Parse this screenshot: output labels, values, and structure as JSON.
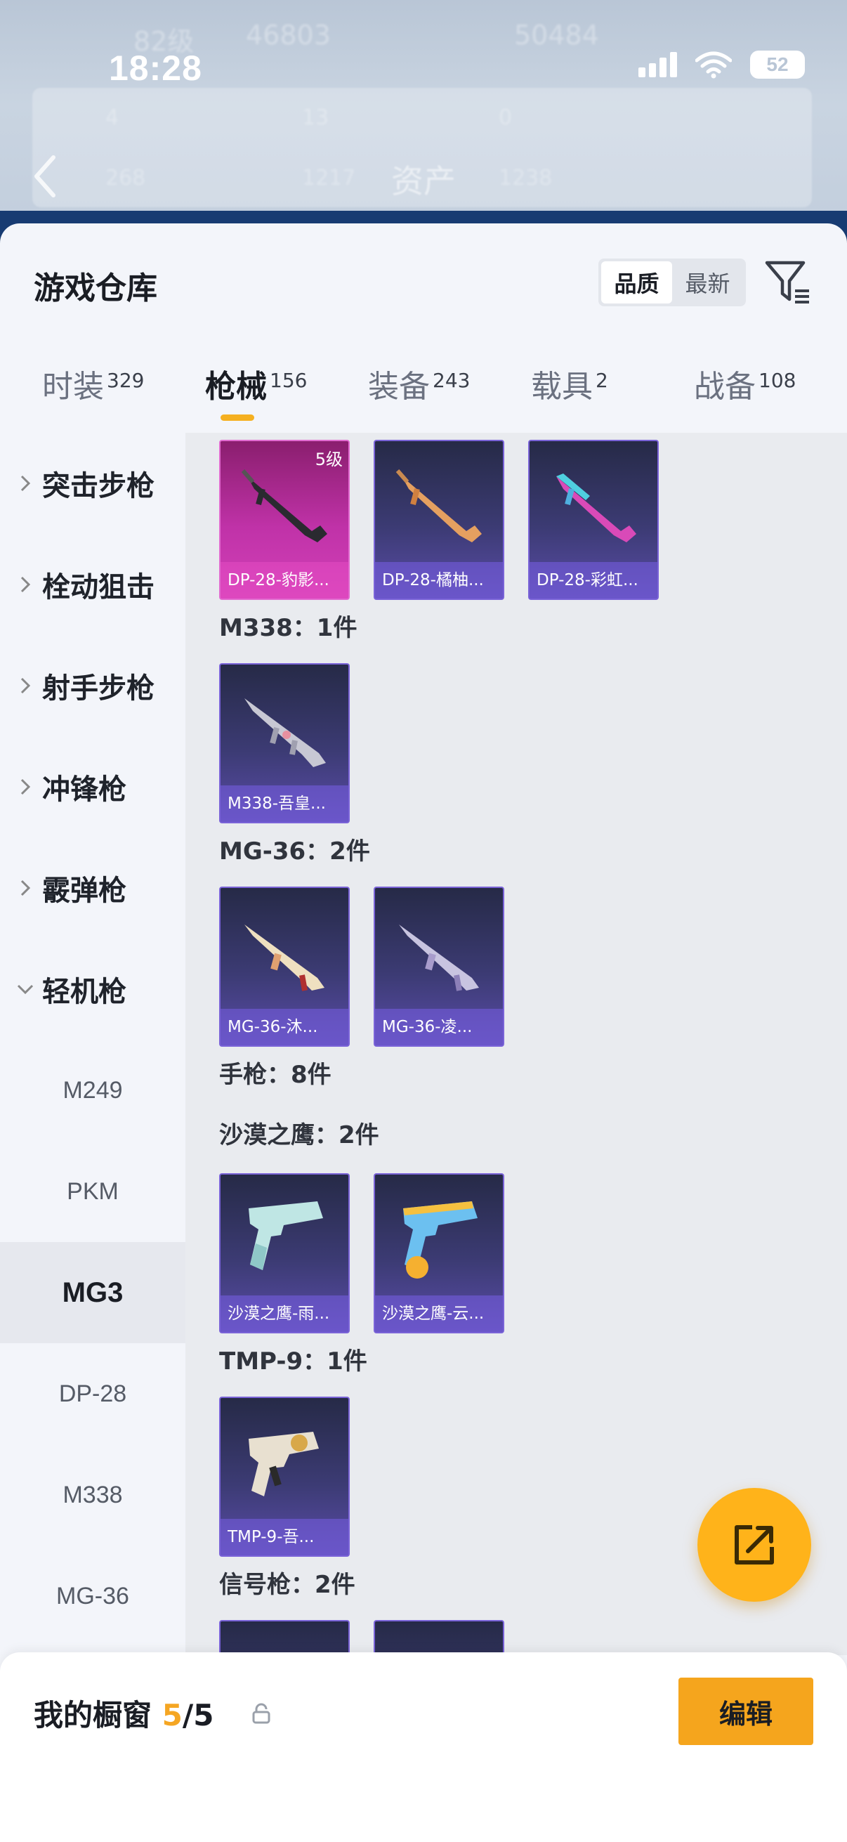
{
  "status_bar": {
    "time": "18:28",
    "battery": "52"
  },
  "background": {
    "level": "82级",
    "coins": "46803",
    "coins2": "50484",
    "stats": [
      "4",
      "13",
      "0",
      "268",
      "1217",
      "1238"
    ],
    "title": "资产"
  },
  "sheet": {
    "title": "游戏仓库",
    "sort": {
      "quality": "品质",
      "latest": "最新"
    }
  },
  "tabs": [
    {
      "label": "时装",
      "count": "329"
    },
    {
      "label": "枪械",
      "count": "156"
    },
    {
      "label": "装备",
      "count": "243"
    },
    {
      "label": "载具",
      "count": "2"
    },
    {
      "label": "战备",
      "count": "108"
    }
  ],
  "categories": [
    "突击步枪",
    "栓动狙击",
    "射手步枪",
    "冲锋枪",
    "霰弹枪",
    "轻机枪"
  ],
  "subcategories": [
    "M249",
    "PKM",
    "MG3",
    "DP-28",
    "M338",
    "MG-36"
  ],
  "groups": {
    "m338": "M338：1件",
    "mg36": "MG-36：2件",
    "pistol": "手枪：8件",
    "deagle": "沙漠之鹰：2件",
    "tmp9": "TMP-9：1件",
    "flare": "信号枪：2件"
  },
  "items": {
    "dp28_1": {
      "name": "DP-28-豹影...",
      "level": "5级"
    },
    "dp28_2": {
      "name": "DP-28-橘柚..."
    },
    "dp28_3": {
      "name": "DP-28-彩虹..."
    },
    "m338_1": {
      "name": "M338-吾皇..."
    },
    "mg36_1": {
      "name": "MG-36-沐..."
    },
    "mg36_2": {
      "name": "MG-36-凌..."
    },
    "deagle_1": {
      "name": "沙漠之鹰-雨..."
    },
    "deagle_2": {
      "name": "沙漠之鹰-云..."
    },
    "tmp9_1": {
      "name": "TMP-9-吾..."
    }
  },
  "showcase": {
    "title": "我的橱窗",
    "current": "5",
    "total": "/5",
    "edit": "编辑"
  },
  "colors": {
    "accent": "#f5a51d",
    "legendary": "#c032a8",
    "epic": "#5a4ca8"
  }
}
